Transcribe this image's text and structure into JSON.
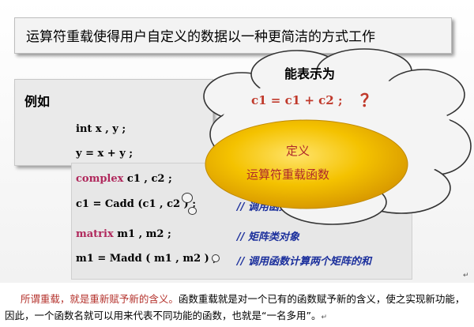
{
  "slide": {
    "title": "运算符重载使得用户自定义的数据以一种更简洁的方式工作",
    "example_label": "例如",
    "code_lines": [
      {
        "kw": "",
        "code": "int  x , y  ;"
      },
      {
        "kw": "",
        "code": "y = x + y ;"
      },
      {
        "kw": "complex",
        "code": "  c1 , c2 ;"
      },
      {
        "kw": "",
        "code": "c1 = Cadd (c1 , c2 ) ;"
      },
      {
        "kw": "matrix",
        "code": "  m1 , m2 ;"
      },
      {
        "kw": "",
        "code": "m1 = Madd ( m1 , m2 ) ;"
      }
    ],
    "comments": [
      "// 调用函数计算两个复数的和",
      "// 矩阵类对象",
      "// 调用函数计算两个矩阵的和"
    ],
    "cloud": {
      "heading": "能表示为",
      "expr": "c1 = c1 + c2 ;",
      "question": "？"
    },
    "ellipse": {
      "line1": "定义",
      "line2": "运算符重载函数"
    }
  },
  "note": {
    "red_text": "所谓重载，就是重新赋予新的含义。",
    "body_text": "函数重载就是对一个已有的函数赋予新的含义，使之实现新功能，因此，一个函数名就可以用来代表不同功能的函数，也就是“一名多用”。",
    "mark": "↵"
  },
  "colors": {
    "keyword": "#b0285c",
    "comment": "#1b2f9c",
    "expr_red": "#c0392b",
    "ellipse_gold": "#f0b400"
  }
}
